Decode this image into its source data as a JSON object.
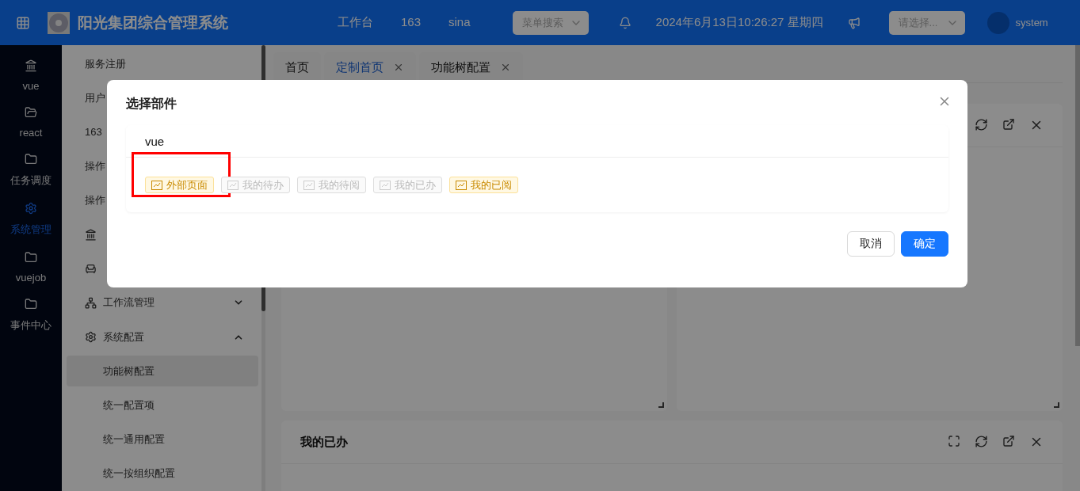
{
  "header": {
    "title": "阳光集团综合管理系统",
    "nav": [
      "工作台",
      "163",
      "sina"
    ],
    "menu_search": {
      "placeholder": "菜单搜索"
    },
    "datetime": "2024年6月13日10:26:27 星期四",
    "select": {
      "placeholder": "请选择..."
    },
    "user": "system"
  },
  "rail": [
    {
      "label": "vue",
      "selected": false
    },
    {
      "label": "react",
      "selected": false
    },
    {
      "label": "任务调度",
      "selected": false
    },
    {
      "label": "系统管理",
      "selected": true
    },
    {
      "label": "vuejob",
      "selected": false
    },
    {
      "label": "事件中心",
      "selected": false
    }
  ],
  "sidebar": [
    {
      "kind": "link",
      "label": "服务注册"
    },
    {
      "kind": "link",
      "label": "用户"
    },
    {
      "kind": "link",
      "label": "163"
    },
    {
      "kind": "link",
      "label": "操作"
    },
    {
      "kind": "link",
      "label": "操作"
    },
    {
      "kind": "icon"
    },
    {
      "kind": "icon"
    },
    {
      "kind": "group",
      "label": "工作流管理",
      "expanded": false
    },
    {
      "kind": "group",
      "label": "系统配置",
      "expanded": true
    },
    {
      "kind": "sub",
      "label": "功能树配置",
      "selected": true
    },
    {
      "kind": "sub",
      "label": "统一配置项",
      "selected": false
    },
    {
      "kind": "sub",
      "label": "统一通用配置",
      "selected": false
    },
    {
      "kind": "sub",
      "label": "统一按组织配置",
      "selected": false
    }
  ],
  "tabs": [
    {
      "label": "首页",
      "selected": false,
      "closable": false
    },
    {
      "label": "定制首页",
      "selected": true,
      "closable": true
    },
    {
      "label": "功能树配置",
      "selected": false,
      "closable": true
    }
  ],
  "bottom_card": {
    "title": "我的已办"
  },
  "dialog": {
    "title": "选择部件",
    "group": "vue",
    "widgets": [
      {
        "label": "外部页面",
        "selected": true,
        "highlighted": true
      },
      {
        "label": "我的待办",
        "selected": false,
        "highlighted": false
      },
      {
        "label": "我的待阅",
        "selected": false,
        "highlighted": false
      },
      {
        "label": "我的已办",
        "selected": false,
        "highlighted": false
      },
      {
        "label": "我的已阅",
        "selected": true,
        "highlighted": false
      }
    ],
    "buttons": [
      {
        "label": "取消",
        "kind": "default"
      },
      {
        "label": "确定",
        "kind": "primary"
      }
    ]
  }
}
